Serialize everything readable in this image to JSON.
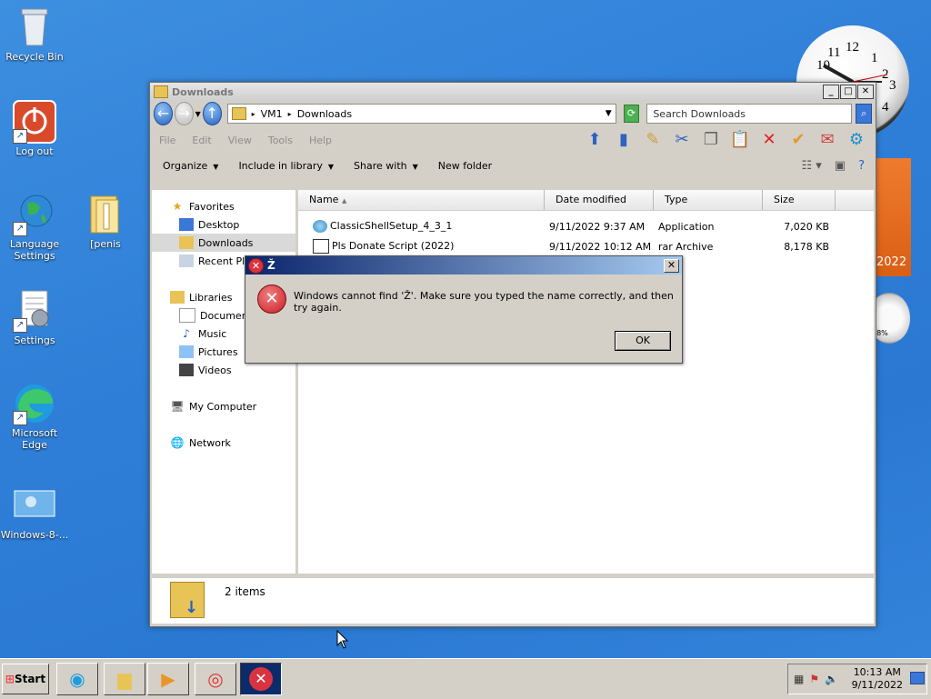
{
  "desktop": {
    "icons": [
      {
        "label": "Recycle Bin"
      },
      {
        "label": "Log out"
      },
      {
        "label": "Language Settings"
      },
      {
        "label": "[penis"
      },
      {
        "label": "Settings"
      },
      {
        "label": "Microsoft Edge"
      },
      {
        "label": "Windows-8-..."
      }
    ]
  },
  "gadgets": {
    "clock_numbers": [
      "12",
      "1",
      "2",
      "3",
      "4",
      "10",
      "11"
    ],
    "calendar_year": "2022",
    "meter_percent": "18%"
  },
  "explorer": {
    "title": "Downloads",
    "address": {
      "segments": [
        "VM1",
        "Downloads"
      ]
    },
    "search_placeholder": "Search Downloads",
    "menu": [
      "File",
      "Edit",
      "View",
      "Tools",
      "Help"
    ],
    "commands": {
      "organize": "Organize",
      "include": "Include in library",
      "share": "Share with",
      "newfolder": "New folder"
    },
    "nav": {
      "favorites": "Favorites",
      "desktop": "Desktop",
      "downloads": "Downloads",
      "recent": "Recent Pla",
      "libraries": "Libraries",
      "documents": "Documents",
      "music": "Music",
      "pictures": "Pictures",
      "videos": "Videos",
      "computer": "My Computer",
      "network": "Network"
    },
    "columns": {
      "name": "Name",
      "date": "Date modified",
      "type": "Type",
      "size": "Size"
    },
    "files": [
      {
        "name": "ClassicShellSetup_4_3_1",
        "date": "9/11/2022 9:37 AM",
        "type": "Application",
        "size": "7,020 KB"
      },
      {
        "name": "Pls Donate Script (2022)",
        "date": "9/11/2022 10:12 AM",
        "type": "rar Archive",
        "size": "8,178 KB"
      }
    ],
    "status": "2 items"
  },
  "dialog": {
    "title": "Ž",
    "message": "Windows cannot find 'Ž'. Make sure you typed the name correctly, and then try again.",
    "ok": "OK"
  },
  "taskbar": {
    "start": "Start",
    "time": "10:13 AM",
    "date": "9/11/2022"
  }
}
